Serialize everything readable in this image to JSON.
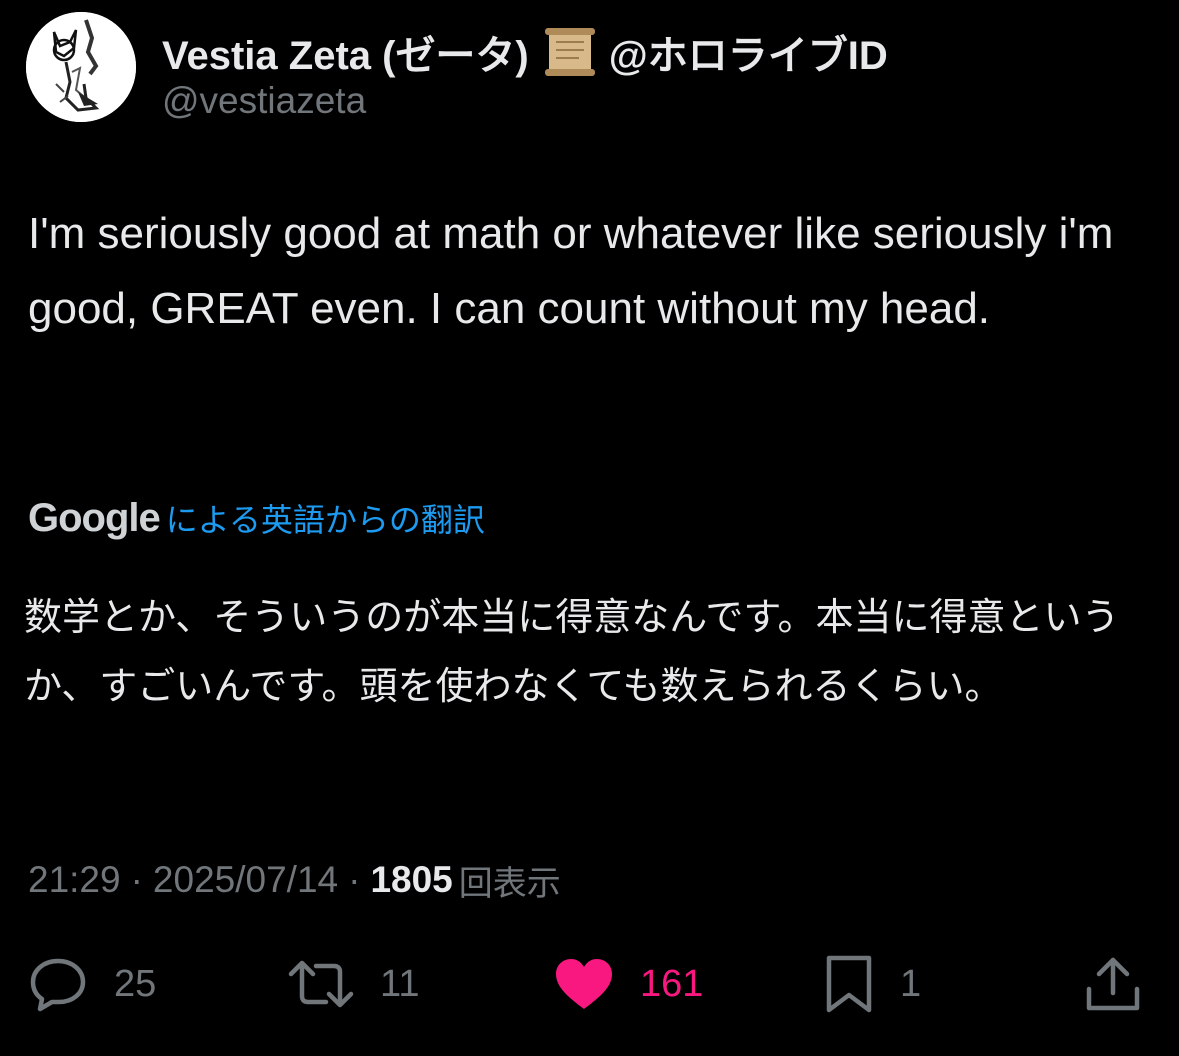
{
  "author": {
    "display_name": "Vestia Zeta (ゼータ)",
    "badge_icon": "scroll-emoji",
    "affiliation": "@ホロライブID",
    "handle": "@vestiazeta"
  },
  "tweet": {
    "text": "I'm seriously good at math or whatever like seriously i'm good, GREAT even. I can count without my head."
  },
  "translation": {
    "provider": "Google",
    "link_text": "による英語からの翻訳",
    "text": "数学とか、そういうのが本当に得意なんです。本当に得意というか、すごいんです。頭を使わなくても数えられるくらい。"
  },
  "meta": {
    "time": "21:29",
    "separator": "·",
    "date": "2025/07/14",
    "views_count": "1805",
    "views_label": "回表示"
  },
  "actions": {
    "reply_count": "25",
    "retweet_count": "11",
    "like_count": "161",
    "bookmark_count": "1"
  },
  "colors": {
    "background": "#000000",
    "text": "#e7e9ea",
    "secondary": "#71767b",
    "link": "#1d9bf0",
    "like": "#f91880"
  }
}
